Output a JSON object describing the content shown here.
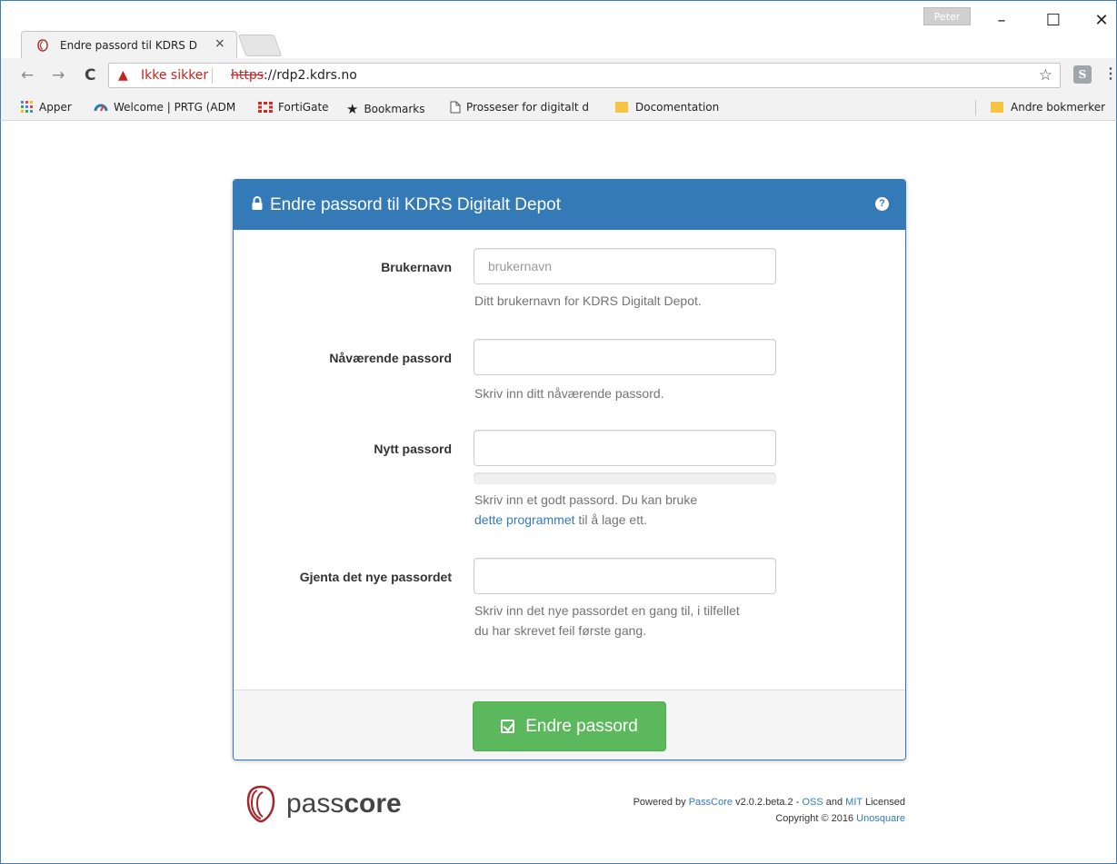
{
  "browser": {
    "tab_title": "Endre passord til KDRS D",
    "tab_close": "×",
    "user_badge": "Peter",
    "window_controls": {
      "minimize": "–",
      "maximize": "☐",
      "close": "✕"
    },
    "nav": {
      "back": "←",
      "forward": "→",
      "reload": "C"
    },
    "omnibox": {
      "warning_icon": "▲",
      "security_label": "Ikke sikker",
      "url_scheme": "https",
      "url_rest": "://rdp2.kdrs.no",
      "bookmark_star": "☆"
    },
    "extension_label": "S",
    "menu": "⋮",
    "bookmarks": [
      {
        "icon": "apps-grid-icon",
        "label": "Apper"
      },
      {
        "icon": "prtg-icon",
        "label": "Welcome | PRTG (ADM"
      },
      {
        "icon": "fortigate-icon",
        "label": "FortiGate"
      },
      {
        "icon": "star-icon",
        "label": "Bookmarks"
      },
      {
        "icon": "page-icon",
        "label": "Prosseser for digitalt d"
      },
      {
        "icon": "folder-icon",
        "label": "Docomentation"
      }
    ],
    "other_bookmarks": "Andre bokmerker"
  },
  "panel": {
    "title": "Endre passord til KDRS Digitalt Depot",
    "help_icon": "?",
    "fields": {
      "username": {
        "label": "Brukernavn",
        "placeholder": "brukernavn",
        "help": "Ditt brukernavn for KDRS Digitalt Depot."
      },
      "current_password": {
        "label": "Nåværende passord",
        "help": "Skriv inn ditt nåværende passord."
      },
      "new_password": {
        "label": "Nytt passord",
        "help_prefix": "Skriv inn et godt passord. Du kan bruke",
        "help_link": "dette programmet",
        "help_suffix": " til å lage ett.",
        "strength": 0
      },
      "repeat_password": {
        "label": "Gjenta det nye passordet",
        "help": "Skriv inn det nye passordet en gang til, i tilfellet du har skrevet feil første gang."
      }
    },
    "submit_label": "Endre passord"
  },
  "footer": {
    "logo_light": "pass",
    "logo_bold": "core",
    "powered_prefix": "Powered by ",
    "powered_link": "PassCore",
    "version": " v2.0.2.beta.2 - ",
    "oss": "OSS",
    "and": " and ",
    "mit": "MIT",
    "licensed": " Licensed",
    "copyright": "Copyright © 2016 ",
    "company": "Unosquare"
  },
  "colors": {
    "primary": "#337ab7",
    "success": "#5cb85c",
    "insecure": "#c5221f"
  }
}
